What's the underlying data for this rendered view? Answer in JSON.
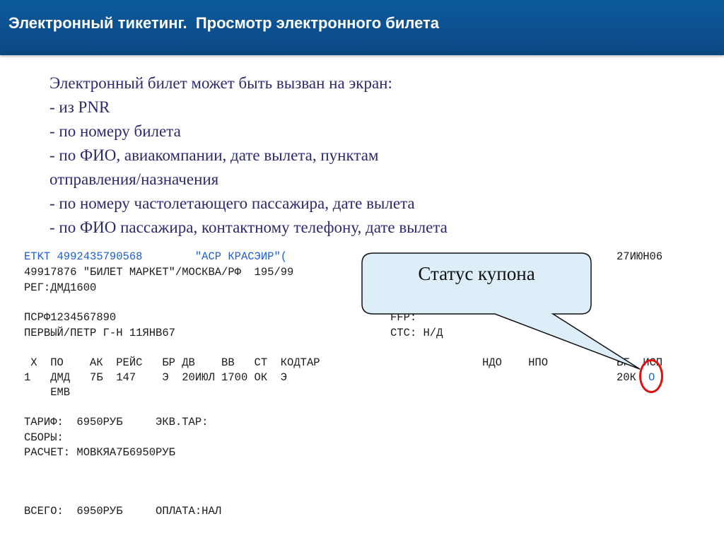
{
  "header": {
    "title": "Электронный тикетинг.  Просмотр электронного билета"
  },
  "intro": {
    "lines": [
      "Электронный билет может быть вызван на экран:",
      "- из PNR",
      "- по номеру билета",
      "- по ФИО, авиакомпании, дате вылета, пунктам",
      "отправления/назначения",
      "- по номеру частолетающего пассажира, дате вылета",
      "- по ФИО пассажира, контактному телефону, дате вылета"
    ]
  },
  "ticket": {
    "line1_left": "ETKT 4992435790568        \"АСР КРАСЭИР\"(",
    "line1_right": "27ИЮН06",
    "line2": "49917876 \"БИЛЕТ МАРКЕТ\"/МОСКВА/РФ  195/99",
    "line3": "РЕГ:ДМД1600",
    "line4_left": "ПСРФ1234567890",
    "line4_right": "FFP:",
    "line5_left": "ПЕРВЫЙ/ПЕТР Г-Н 11ЯНВ67",
    "line5_right": "СТС: Н/Д",
    "columns_header_left": " X  ПО    АК  РЕЙС   БР ДВ    ВВ   СТ  КОДТАР",
    "columns_header_mid": "НДО    НПО",
    "columns_header_right": "БГ  ИСП",
    "segment_left": "1   ДМД   7Б  147    Э  20ИЮЛ 1700 ОК  Э",
    "segment_right": "20К",
    "segment_status": "O",
    "aircraft": "    EMB",
    "fare": "ТАРИФ:  6950РУБ     ЭКВ.ТАР:",
    "taxes": "СБОРЫ:",
    "calc": "РАСЧЕТ: МОВКЯА7Б6950РУБ",
    "total": "ВСЕГО:  6950РУБ     ОПЛАТА:НАЛ"
  },
  "callout": {
    "label": "Статус купона",
    "fill_color": "#ddeef9",
    "circle_color": "#e01010"
  },
  "colors": {
    "header": "#0d4f8e",
    "intro_text": "#2a2a6e",
    "blue_text": "#1d5fd1"
  }
}
